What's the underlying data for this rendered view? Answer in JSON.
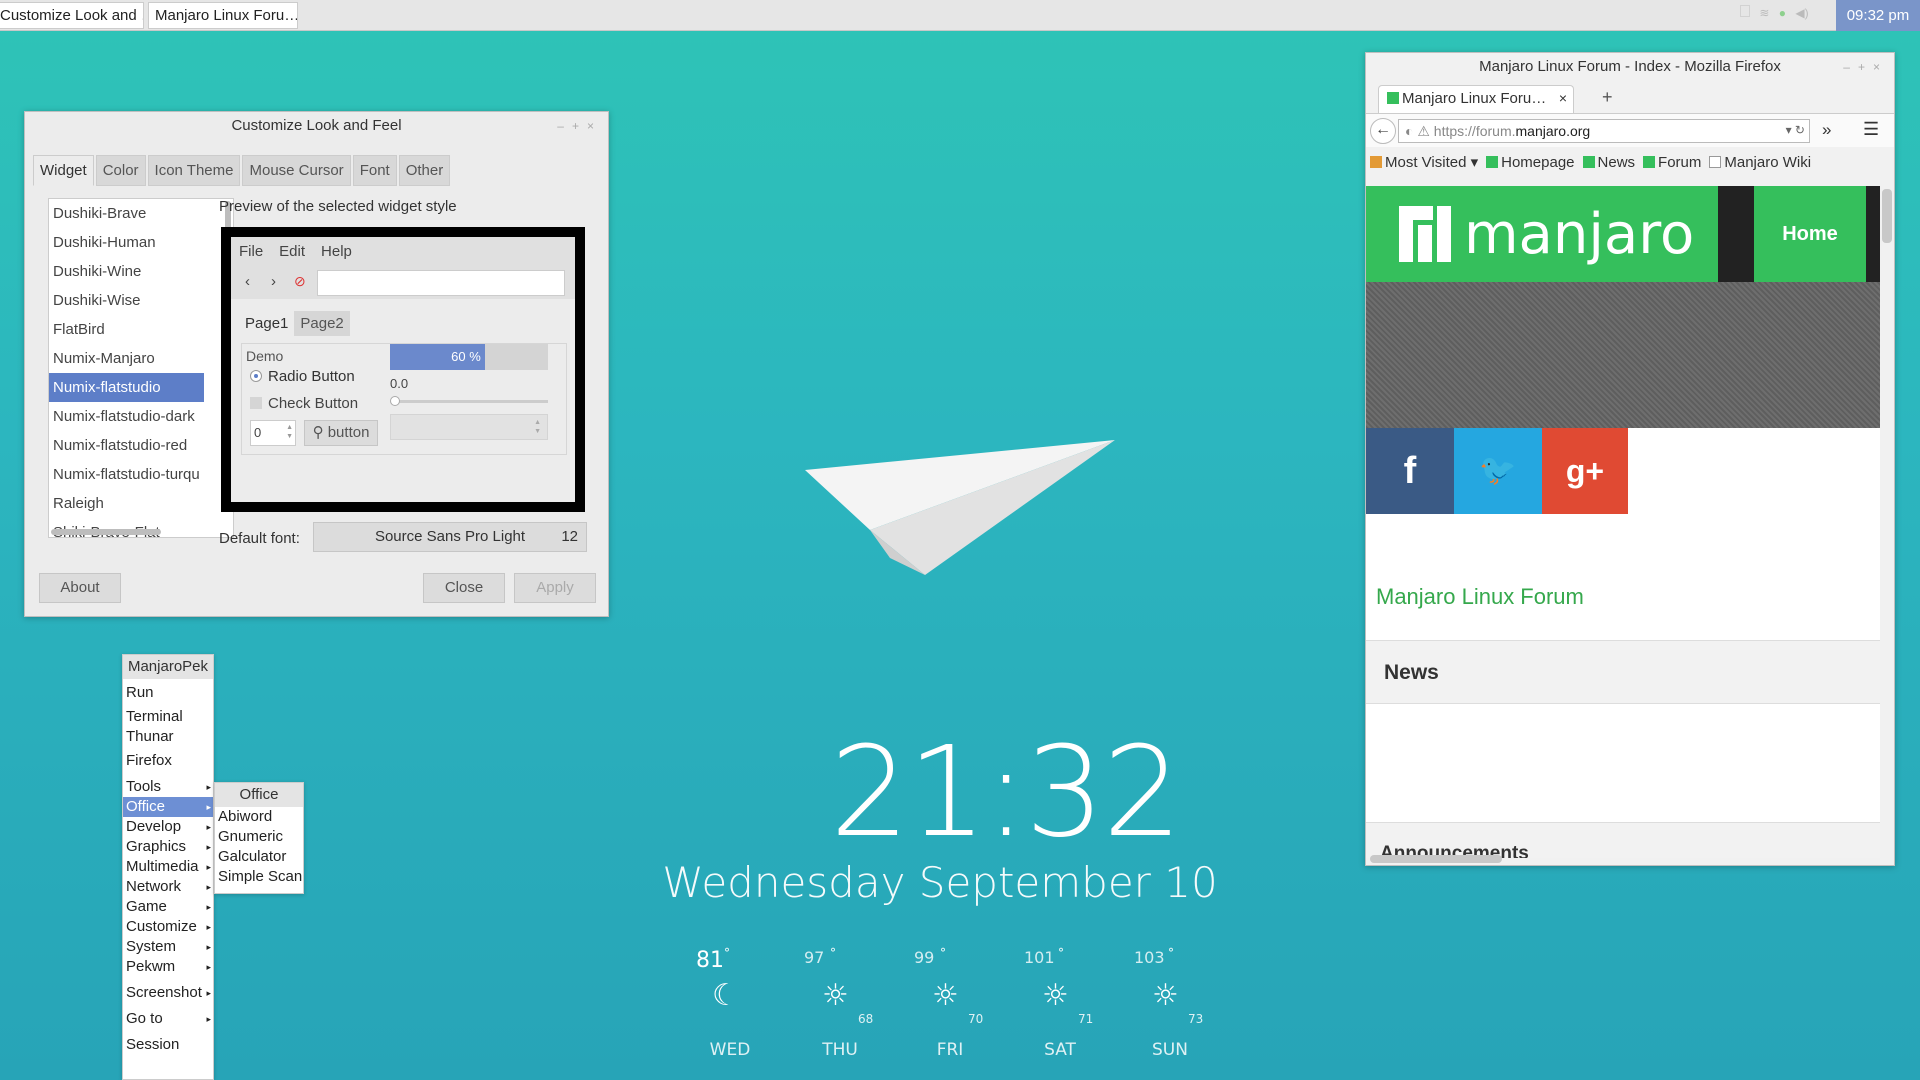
{
  "taskbar": {
    "tasks": [
      "Customize Look and …",
      "Manjaro Linux Foru…"
    ],
    "clock": "09:32 pm"
  },
  "customize": {
    "title": "Customize Look and Feel",
    "tabs": [
      "Widget",
      "Color",
      "Icon Theme",
      "Mouse Cursor",
      "Font",
      "Other"
    ],
    "themes": [
      "Dushiki-Brave",
      "Dushiki-Human",
      "Dushiki-Wine",
      "Dushiki-Wise",
      "FlatBird",
      "Numix-Manjaro",
      "Numix-flatstudio",
      "Numix-flatstudio-dark",
      "Numix-flatstudio-red",
      "Numix-flatstudio-turqu",
      "Raleigh",
      "Shiki-Brave-Flat"
    ],
    "selected_index": 6,
    "preview_label": "Preview of the selected widget style",
    "preview": {
      "menu": [
        "File",
        "Edit",
        "Help"
      ],
      "tabs": [
        "Page1",
        "Page2"
      ],
      "demo_label": "Demo",
      "radio_label": "Radio Button",
      "check_label": "Check Button",
      "spin_value": "0",
      "button_label": "button",
      "progress_text": "60 %",
      "progress_fraction": 0.6,
      "scale_value": "0.0"
    },
    "default_font_label": "Default font:",
    "font_name": "Source Sans Pro Light",
    "font_size": "12",
    "about": "About",
    "close": "Close",
    "apply": "Apply"
  },
  "menu": {
    "header": "ManjaroPek",
    "items": [
      "Run",
      "Terminal",
      "Thunar",
      "Firefox",
      "Tools",
      "Office",
      "Develop",
      "Graphics",
      "Multimedia",
      "Network",
      "Game",
      "Customize",
      "System",
      "Pekwm",
      "Screenshot",
      "Go to",
      "Session"
    ],
    "submenu_header": "Office",
    "submenu": [
      "Abiword",
      "Gnumeric",
      "Galculator",
      "Simple Scan"
    ]
  },
  "firefox": {
    "title": "Manjaro Linux Forum - Index - Mozilla Firefox",
    "tab_label": "Manjaro Linux Foru…",
    "url_prefix": "https://forum.",
    "url_domain": "manjaro.org",
    "bookmarks": [
      "Most Visited ▾",
      "Homepage",
      "News",
      "Forum",
      "Manjaro Wiki"
    ],
    "logo_text": "manjaro",
    "home": "Home",
    "forum_title": "Manjaro Linux Forum",
    "news": "News",
    "announcements": "Announcements"
  },
  "desktop": {
    "time": "21:32",
    "date": "Wednesday September 10",
    "weather": [
      {
        "day": "WED",
        "high": "81",
        "low": "",
        "icon": "moon-icon"
      },
      {
        "day": "THU",
        "high": "97",
        "low": "68",
        "icon": "sun-icon"
      },
      {
        "day": "FRI",
        "high": "99",
        "low": "70",
        "icon": "sun-icon"
      },
      {
        "day": "SAT",
        "high": "101",
        "low": "71",
        "icon": "sun-icon"
      },
      {
        "day": "SUN",
        "high": "103",
        "low": "73",
        "icon": "sun-icon"
      }
    ]
  }
}
